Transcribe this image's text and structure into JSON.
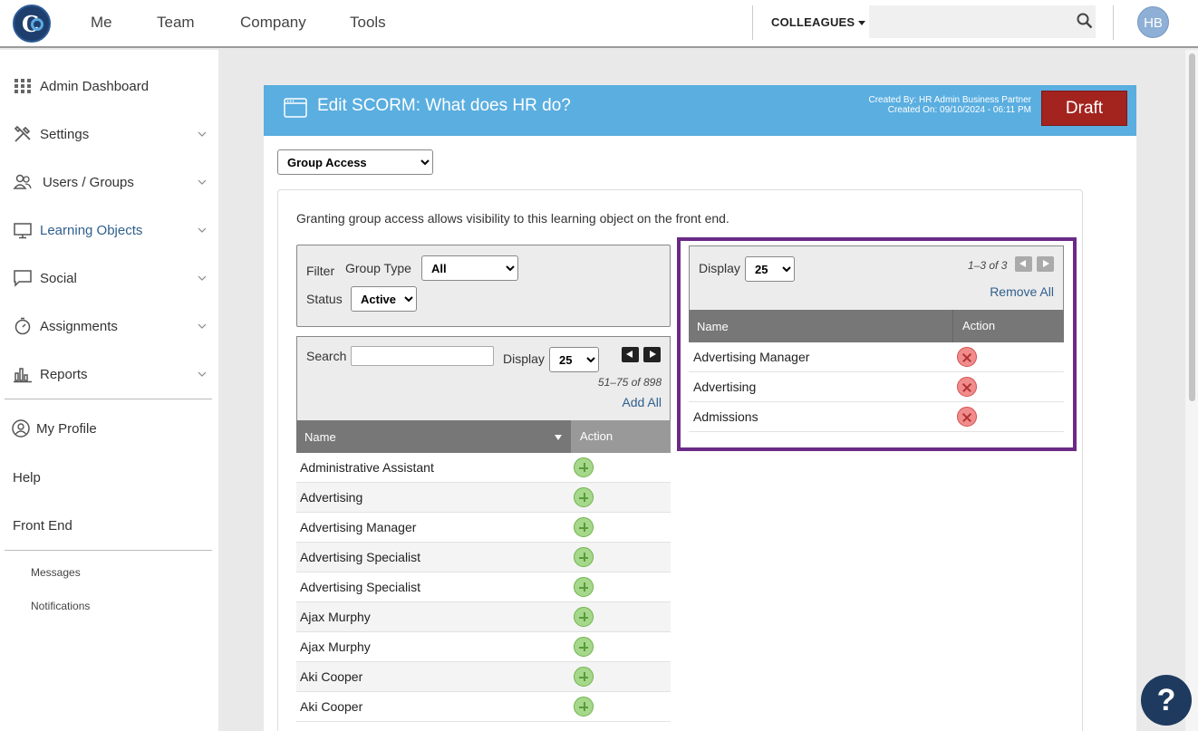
{
  "topnav": {
    "items": [
      "Me",
      "Team",
      "Company",
      "Tools"
    ],
    "colleagues_label": "COLLEAGUES",
    "search_placeholder": "",
    "avatar_initials": "HB"
  },
  "sidebar": {
    "items": [
      {
        "label": "Admin Dashboard",
        "icon": "grid-icon",
        "has_chevron": false
      },
      {
        "label": "Settings",
        "icon": "tools-icon",
        "has_chevron": true
      },
      {
        "label": "Users / Groups",
        "icon": "users-icon",
        "has_chevron": true
      },
      {
        "label": "Learning Objects",
        "icon": "monitor-icon",
        "has_chevron": true,
        "active": true
      },
      {
        "label": "Social",
        "icon": "chat-icon",
        "has_chevron": true
      },
      {
        "label": "Assignments",
        "icon": "stopwatch-icon",
        "has_chevron": true
      },
      {
        "label": "Reports",
        "icon": "bar-chart-icon",
        "has_chevron": true
      }
    ],
    "my_profile": "My Profile",
    "help": "Help",
    "front_end": "Front End",
    "messages": "Messages",
    "notifications": "Notifications"
  },
  "card": {
    "title": "Edit SCORM: What does HR do?",
    "created_by": "Created By: HR Admin Business Partner",
    "created_on": "Created On: 09/10/2024 - 06:11 PM",
    "draft_label": "Draft",
    "access_select_value": "Group Access",
    "description": "Granting group access allows visibility to this learning object on the front end."
  },
  "filter": {
    "label": "Filter",
    "group_type_label": "Group Type",
    "group_type_value": "All",
    "status_label": "Status",
    "status_value": "Active"
  },
  "available": {
    "search_label": "Search",
    "display_label": "Display",
    "display_value": "25",
    "page_info": "51–75 of 898",
    "add_all_label": "Add All",
    "col_name": "Name",
    "col_action": "Action",
    "rows": [
      "Administrative Assistant",
      "Advertising",
      "Advertising Manager",
      "Advertising Specialist",
      "Advertising Specialist",
      "Ajax Murphy",
      "Ajax Murphy",
      "Aki Cooper",
      "Aki Cooper"
    ]
  },
  "selected": {
    "display_label": "Display",
    "display_value": "25",
    "page_info": "1–3 of 3",
    "remove_all_label": "Remove All",
    "col_name": "Name",
    "col_action": "Action",
    "rows": [
      "Advertising Manager",
      "Advertising",
      "Admissions"
    ]
  },
  "help_button": "?",
  "colors": {
    "header_blue": "#5aaee0",
    "draft_red": "#a3231f",
    "highlight_purple": "#6a2a85",
    "link_blue": "#2f5f8e"
  }
}
